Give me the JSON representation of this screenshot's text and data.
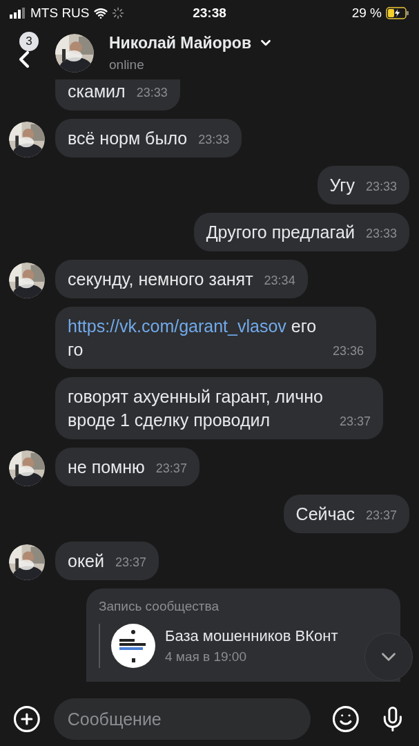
{
  "status_bar": {
    "carrier": "MTS RUS",
    "time": "23:38",
    "battery": "29 %",
    "charging": true
  },
  "header": {
    "back_badge": "3",
    "name": "Николай Майоров",
    "status": "online"
  },
  "messages": [
    {
      "kind": "cut",
      "outgoing": false,
      "avatar": false,
      "text": "скамил",
      "time": "23:33"
    },
    {
      "kind": "text",
      "outgoing": false,
      "avatar": true,
      "text": "всё норм было",
      "time": "23:33"
    },
    {
      "kind": "text",
      "outgoing": true,
      "avatar": false,
      "text": "Угу",
      "time": "23:33"
    },
    {
      "kind": "text",
      "outgoing": true,
      "avatar": false,
      "text": "Другого предлагай",
      "time": "23:33"
    },
    {
      "kind": "text",
      "outgoing": false,
      "avatar": true,
      "text": "секунду, немного занят",
      "time": "23:34"
    },
    {
      "kind": "link",
      "outgoing": false,
      "avatar": false,
      "link": "https://vk.com/garant_vlasov",
      "text": "его го",
      "time": "23:36"
    },
    {
      "kind": "text",
      "outgoing": false,
      "avatar": false,
      "text": "говорят ахуенный гарант, лично вроде 1 сделку проводил",
      "time": "23:37"
    },
    {
      "kind": "text",
      "outgoing": false,
      "avatar": true,
      "text": "не помню",
      "time": "23:37"
    },
    {
      "kind": "text",
      "outgoing": true,
      "avatar": false,
      "text": "Сейчас",
      "time": "23:37"
    },
    {
      "kind": "text",
      "outgoing": false,
      "avatar": true,
      "text": "окей",
      "time": "23:37"
    },
    {
      "kind": "post",
      "outgoing": false,
      "avatar": false,
      "label": "Запись сообщества",
      "community": "База мошенников ВКонт",
      "date": "4 мая в 19:00"
    }
  ],
  "composer": {
    "placeholder": "Сообщение"
  }
}
